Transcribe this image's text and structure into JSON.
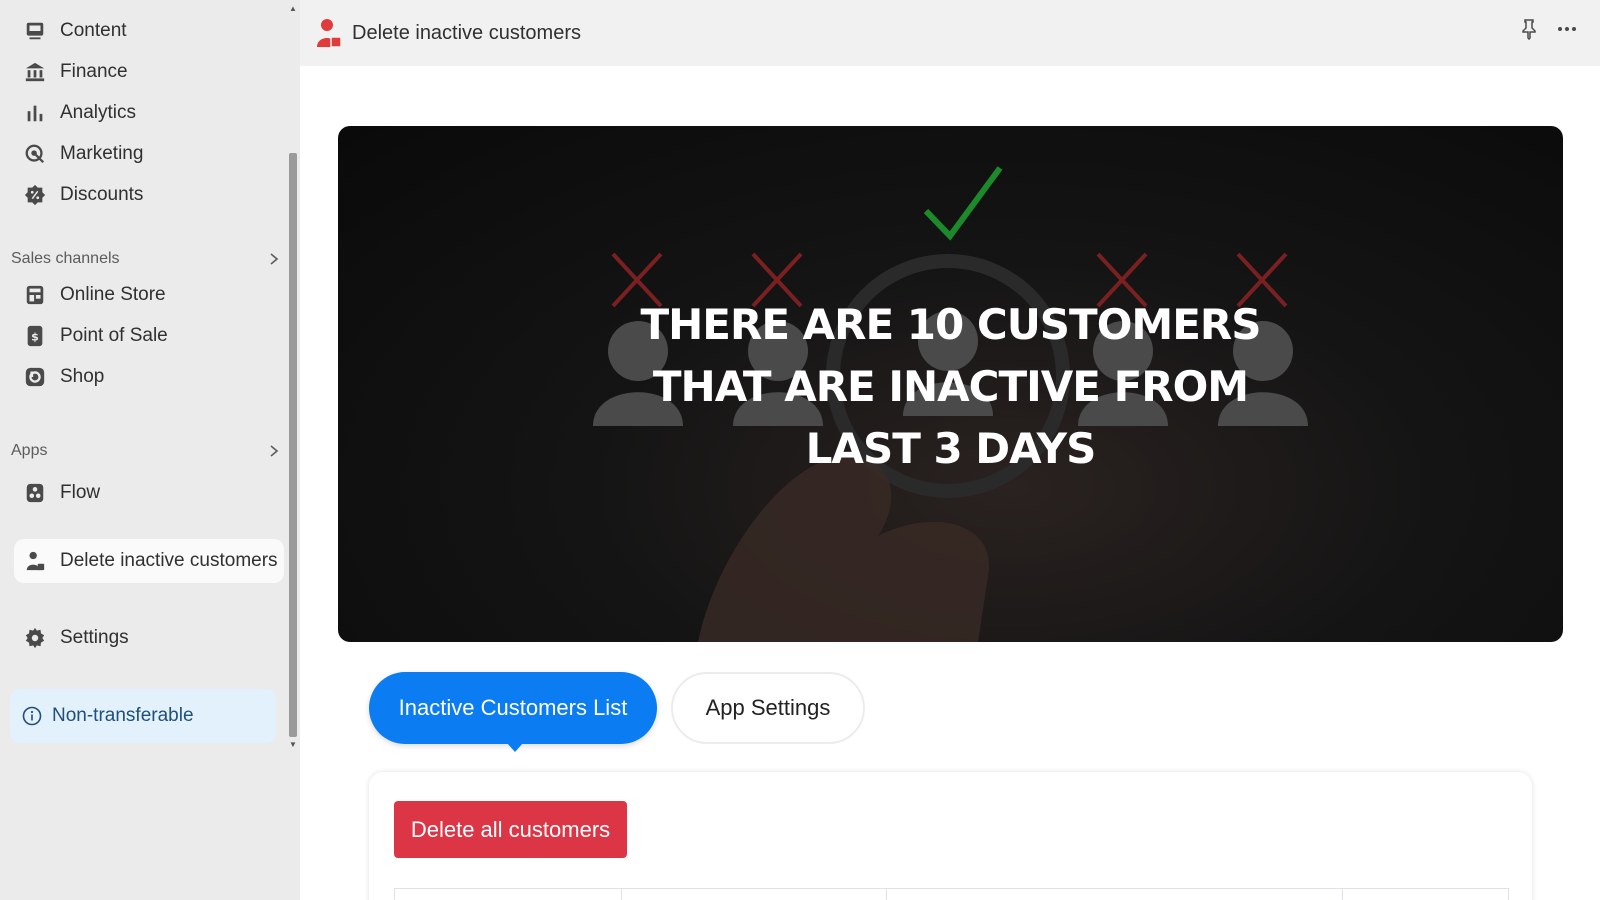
{
  "sidebar": {
    "items": [
      {
        "label": "Content",
        "icon": "content-icon"
      },
      {
        "label": "Finance",
        "icon": "bank-icon"
      },
      {
        "label": "Analytics",
        "icon": "bar-chart-icon"
      },
      {
        "label": "Marketing",
        "icon": "target-icon"
      },
      {
        "label": "Discounts",
        "icon": "discount-badge-icon"
      }
    ],
    "sales_channels_label": "Sales channels",
    "sales_channels": [
      {
        "label": "Online Store",
        "icon": "store-icon"
      },
      {
        "label": "Point of Sale",
        "icon": "pos-icon"
      },
      {
        "label": "Shop",
        "icon": "shop-icon"
      }
    ],
    "apps_label": "Apps",
    "apps": [
      {
        "label": "Flow",
        "icon": "flow-icon"
      },
      {
        "label": "Delete inactive customers",
        "icon": "user-delete-icon"
      }
    ],
    "settings_label": "Settings",
    "nontransferable_label": "Non-transferable"
  },
  "topbar": {
    "title": "Delete inactive customers"
  },
  "hero": {
    "line1": "THERE ARE 10 CUSTOMERS",
    "line2": "THAT ARE INACTIVE FROM",
    "line3": "LAST 3 DAYS"
  },
  "tabs": [
    {
      "label": "Inactive Customers List",
      "active": true
    },
    {
      "label": "App Settings",
      "active": false
    }
  ],
  "actions": {
    "delete_all_label": "Delete all customers"
  },
  "colors": {
    "primary": "#0b7cf2",
    "danger": "#dc3545",
    "info_bg": "#e3f1fd"
  }
}
